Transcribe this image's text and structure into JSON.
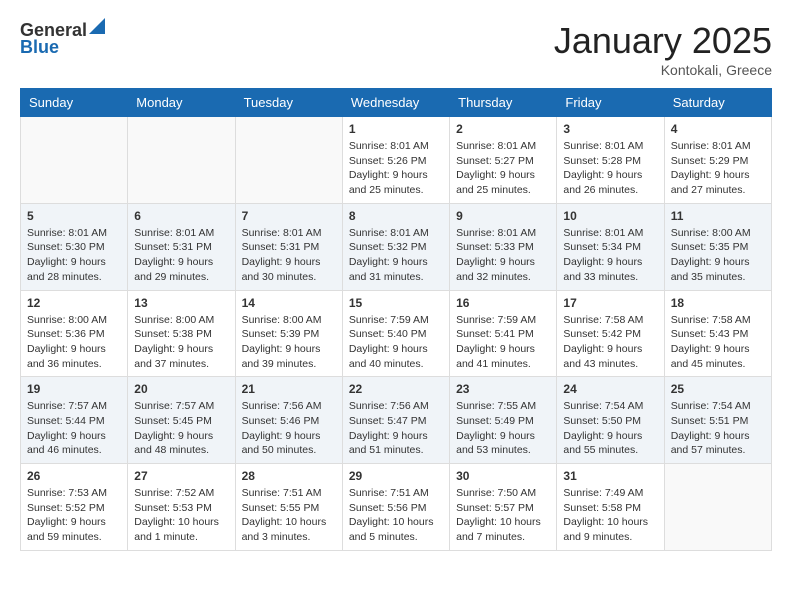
{
  "header": {
    "logo_general": "General",
    "logo_blue": "Blue",
    "month": "January 2025",
    "location": "Kontokali, Greece"
  },
  "days_of_week": [
    "Sunday",
    "Monday",
    "Tuesday",
    "Wednesday",
    "Thursday",
    "Friday",
    "Saturday"
  ],
  "weeks": [
    [
      {
        "num": "",
        "info": ""
      },
      {
        "num": "",
        "info": ""
      },
      {
        "num": "",
        "info": ""
      },
      {
        "num": "1",
        "info": "Sunrise: 8:01 AM\nSunset: 5:26 PM\nDaylight: 9 hours\nand 25 minutes."
      },
      {
        "num": "2",
        "info": "Sunrise: 8:01 AM\nSunset: 5:27 PM\nDaylight: 9 hours\nand 25 minutes."
      },
      {
        "num": "3",
        "info": "Sunrise: 8:01 AM\nSunset: 5:28 PM\nDaylight: 9 hours\nand 26 minutes."
      },
      {
        "num": "4",
        "info": "Sunrise: 8:01 AM\nSunset: 5:29 PM\nDaylight: 9 hours\nand 27 minutes."
      }
    ],
    [
      {
        "num": "5",
        "info": "Sunrise: 8:01 AM\nSunset: 5:30 PM\nDaylight: 9 hours\nand 28 minutes."
      },
      {
        "num": "6",
        "info": "Sunrise: 8:01 AM\nSunset: 5:31 PM\nDaylight: 9 hours\nand 29 minutes."
      },
      {
        "num": "7",
        "info": "Sunrise: 8:01 AM\nSunset: 5:31 PM\nDaylight: 9 hours\nand 30 minutes."
      },
      {
        "num": "8",
        "info": "Sunrise: 8:01 AM\nSunset: 5:32 PM\nDaylight: 9 hours\nand 31 minutes."
      },
      {
        "num": "9",
        "info": "Sunrise: 8:01 AM\nSunset: 5:33 PM\nDaylight: 9 hours\nand 32 minutes."
      },
      {
        "num": "10",
        "info": "Sunrise: 8:01 AM\nSunset: 5:34 PM\nDaylight: 9 hours\nand 33 minutes."
      },
      {
        "num": "11",
        "info": "Sunrise: 8:00 AM\nSunset: 5:35 PM\nDaylight: 9 hours\nand 35 minutes."
      }
    ],
    [
      {
        "num": "12",
        "info": "Sunrise: 8:00 AM\nSunset: 5:36 PM\nDaylight: 9 hours\nand 36 minutes."
      },
      {
        "num": "13",
        "info": "Sunrise: 8:00 AM\nSunset: 5:38 PM\nDaylight: 9 hours\nand 37 minutes."
      },
      {
        "num": "14",
        "info": "Sunrise: 8:00 AM\nSunset: 5:39 PM\nDaylight: 9 hours\nand 39 minutes."
      },
      {
        "num": "15",
        "info": "Sunrise: 7:59 AM\nSunset: 5:40 PM\nDaylight: 9 hours\nand 40 minutes."
      },
      {
        "num": "16",
        "info": "Sunrise: 7:59 AM\nSunset: 5:41 PM\nDaylight: 9 hours\nand 41 minutes."
      },
      {
        "num": "17",
        "info": "Sunrise: 7:58 AM\nSunset: 5:42 PM\nDaylight: 9 hours\nand 43 minutes."
      },
      {
        "num": "18",
        "info": "Sunrise: 7:58 AM\nSunset: 5:43 PM\nDaylight: 9 hours\nand 45 minutes."
      }
    ],
    [
      {
        "num": "19",
        "info": "Sunrise: 7:57 AM\nSunset: 5:44 PM\nDaylight: 9 hours\nand 46 minutes."
      },
      {
        "num": "20",
        "info": "Sunrise: 7:57 AM\nSunset: 5:45 PM\nDaylight: 9 hours\nand 48 minutes."
      },
      {
        "num": "21",
        "info": "Sunrise: 7:56 AM\nSunset: 5:46 PM\nDaylight: 9 hours\nand 50 minutes."
      },
      {
        "num": "22",
        "info": "Sunrise: 7:56 AM\nSunset: 5:47 PM\nDaylight: 9 hours\nand 51 minutes."
      },
      {
        "num": "23",
        "info": "Sunrise: 7:55 AM\nSunset: 5:49 PM\nDaylight: 9 hours\nand 53 minutes."
      },
      {
        "num": "24",
        "info": "Sunrise: 7:54 AM\nSunset: 5:50 PM\nDaylight: 9 hours\nand 55 minutes."
      },
      {
        "num": "25",
        "info": "Sunrise: 7:54 AM\nSunset: 5:51 PM\nDaylight: 9 hours\nand 57 minutes."
      }
    ],
    [
      {
        "num": "26",
        "info": "Sunrise: 7:53 AM\nSunset: 5:52 PM\nDaylight: 9 hours\nand 59 minutes."
      },
      {
        "num": "27",
        "info": "Sunrise: 7:52 AM\nSunset: 5:53 PM\nDaylight: 10 hours\nand 1 minute."
      },
      {
        "num": "28",
        "info": "Sunrise: 7:51 AM\nSunset: 5:55 PM\nDaylight: 10 hours\nand 3 minutes."
      },
      {
        "num": "29",
        "info": "Sunrise: 7:51 AM\nSunset: 5:56 PM\nDaylight: 10 hours\nand 5 minutes."
      },
      {
        "num": "30",
        "info": "Sunrise: 7:50 AM\nSunset: 5:57 PM\nDaylight: 10 hours\nand 7 minutes."
      },
      {
        "num": "31",
        "info": "Sunrise: 7:49 AM\nSunset: 5:58 PM\nDaylight: 10 hours\nand 9 minutes."
      },
      {
        "num": "",
        "info": ""
      }
    ]
  ]
}
